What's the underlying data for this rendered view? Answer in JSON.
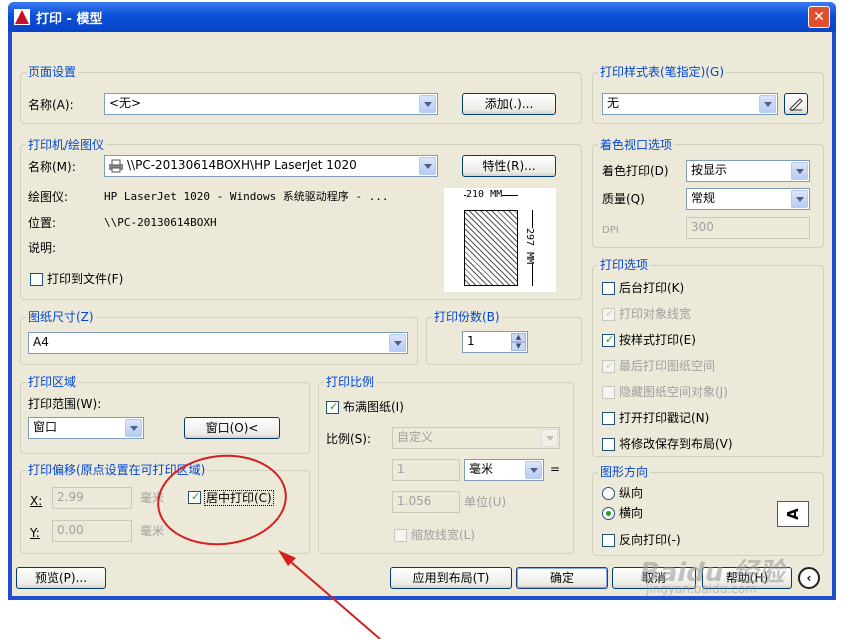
{
  "window": {
    "title": "打印 - 模型",
    "close": "✕"
  },
  "page_setup": {
    "legend": "页面设置",
    "name_label": "名称(A):",
    "name_value": "<无>",
    "add_button": "添加(.)..."
  },
  "printer": {
    "legend": "打印机/绘图仪",
    "name_label": "名称(M):",
    "name_value": "\\\\PC-20130614BOXH\\HP LaserJet 1020",
    "props_button": "特性(R)...",
    "plotter_label": "绘图仪:",
    "plotter_value": "HP LaserJet 1020 - Windows 系统驱动程序 - ...",
    "where_label": "位置:",
    "where_value": "\\\\PC-20130614BOXH",
    "desc_label": "说明:",
    "print_to_file": "打印到文件(F)",
    "preview_width": "210 MM",
    "preview_height": "297 MM"
  },
  "paper": {
    "legend": "图纸尺寸(Z)",
    "value": "A4"
  },
  "copies": {
    "legend": "打印份数(B)",
    "value": "1"
  },
  "area": {
    "legend": "打印区域",
    "range_label": "打印范围(W):",
    "range_value": "窗口",
    "window_button": "窗口(O)<"
  },
  "offset": {
    "legend": "打印偏移(原点设置在可打印区域)",
    "x_label": "X:",
    "x_value": "2.99",
    "x_unit": "毫米",
    "y_label": "Y:",
    "y_value": "0.00",
    "y_unit": "毫米",
    "center": "居中打印(C)",
    "center_checked": true
  },
  "scale": {
    "legend": "打印比例",
    "fit": "布满图纸(I)",
    "fit_checked": true,
    "scale_label": "比例(S):",
    "scale_value": "自定义",
    "v1": "1",
    "unit": "毫米",
    "eq": "=",
    "v2": "1.056",
    "unit2": "单位(U)",
    "lineweights": "缩放线宽(L)"
  },
  "style_table": {
    "legend": "打印样式表(笔指定)(G)",
    "value": "无"
  },
  "shaded": {
    "legend": "着色视口选项",
    "shade_label": "着色打印(D)",
    "shade_value": "按显示",
    "quality_label": "质量(Q)",
    "quality_value": "常规",
    "dpi_label": "DPI",
    "dpi_value": "300"
  },
  "options": {
    "legend": "打印选项",
    "items": [
      {
        "label": "后台打印(K)",
        "checked": false,
        "disabled": false
      },
      {
        "label": "打印对象线宽",
        "checked": true,
        "disabled": true
      },
      {
        "label": "按样式打印(E)",
        "checked": true,
        "disabled": false
      },
      {
        "label": "最后打印图纸空间",
        "checked": true,
        "disabled": true
      },
      {
        "label": "隐藏图纸空间对象(J)",
        "checked": false,
        "disabled": true
      },
      {
        "label": "打开打印戳记(N)",
        "checked": false,
        "disabled": false
      },
      {
        "label": "将修改保存到布局(V)",
        "checked": false,
        "disabled": false
      }
    ]
  },
  "orientation": {
    "legend": "图形方向",
    "portrait": "纵向",
    "landscape": "横向",
    "landscape_selected": true,
    "upside": "反向打印(-)",
    "icon_letter": "A"
  },
  "buttons": {
    "preview": "预览(P)...",
    "apply": "应用到布局(T)",
    "ok": "确定",
    "cancel": "取消",
    "help": "帮助(H)"
  },
  "watermark": {
    "text": "Baidu 经验",
    "url": "jingyan.baidu.com"
  },
  "colors": {
    "accent": "#0046d5",
    "annotation": "#d42020"
  }
}
